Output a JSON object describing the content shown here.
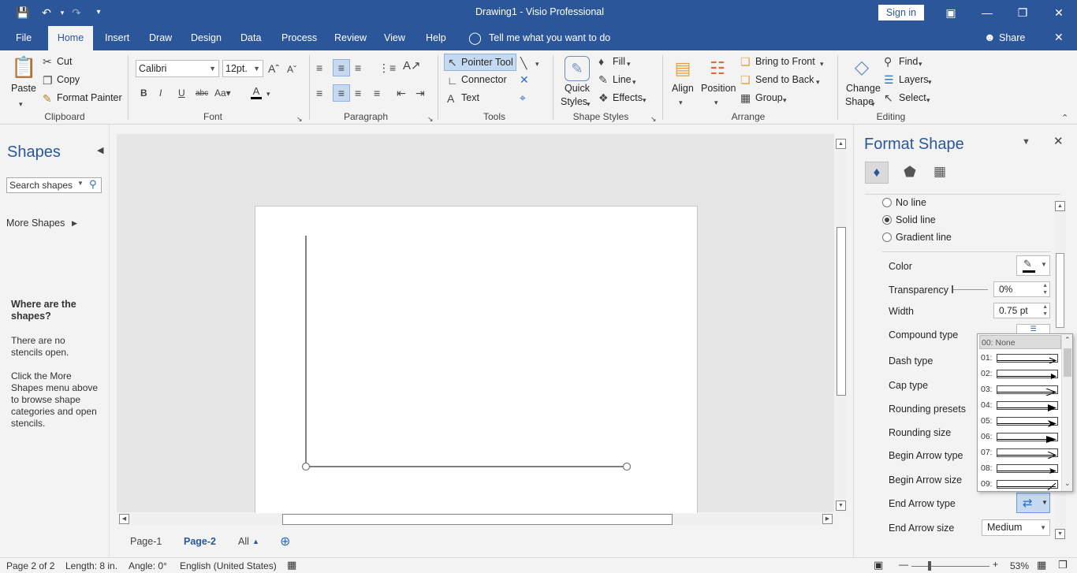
{
  "window": {
    "title": "Drawing1  -  Visio Professional",
    "sign_in": "Sign in"
  },
  "colors": {
    "brand": "#2b579a",
    "canvas": "#e6e6e6",
    "selected_button": "#c5d9f1"
  },
  "menu": {
    "tabs": [
      "File",
      "Home",
      "Insert",
      "Draw",
      "Design",
      "Data",
      "Process",
      "Review",
      "View",
      "Help"
    ],
    "tell_me": "Tell me what you want to do",
    "share": "Share"
  },
  "ribbon": {
    "clipboard": {
      "paste": "Paste",
      "cut": "Cut",
      "copy": "Copy",
      "format_painter": "Format Painter",
      "group": "Clipboard"
    },
    "font": {
      "name": "Calibri",
      "size": "12pt.",
      "group": "Font"
    },
    "paragraph": {
      "group": "Paragraph"
    },
    "tools": {
      "pointer": "Pointer Tool",
      "connector": "Connector",
      "text": "Text",
      "group": "Tools"
    },
    "shape_styles": {
      "quick": "Quick",
      "styles": "Styles",
      "fill": "Fill",
      "line": "Line",
      "effects": "Effects",
      "group": "Shape Styles"
    },
    "arrange": {
      "align": "Align",
      "position": "Position",
      "bring_front": "Bring to Front",
      "send_back": "Send to Back",
      "group_btn": "Group",
      "group": "Arrange"
    },
    "editing": {
      "change": "Change",
      "shape": "Shape",
      "find": "Find",
      "layers": "Layers",
      "select": "Select",
      "group": "Editing"
    }
  },
  "shapes_panel": {
    "title": "Shapes",
    "search_placeholder": "Search shapes",
    "more_shapes": "More Shapes",
    "where_title": "Where are the shapes?",
    "no_stencils": "There are no stencils open.",
    "hint": "Click the More Shapes menu above to browse shape categories and open stencils."
  },
  "pages": {
    "tabs": [
      "Page-1",
      "Page-2"
    ],
    "all": "All",
    "active": "Page-2"
  },
  "status": {
    "page": "Page 2 of 2",
    "length": "Length: 8 in.",
    "angle": "Angle: 0°",
    "language": "English (United States)",
    "zoom": "53%",
    "zoom_fraction": 0.53
  },
  "format_shape": {
    "title": "Format Shape",
    "line_options": [
      "No line",
      "Solid line",
      "Gradient line"
    ],
    "selected_line_option": "Solid line",
    "labels": {
      "color": "Color",
      "transparency": "Transparency",
      "width": "Width",
      "compound": "Compound type",
      "dash": "Dash type",
      "cap": "Cap type",
      "rounding_presets": "Rounding presets",
      "rounding_size": "Rounding size",
      "begin_type": "Begin Arrow type",
      "begin_size": "Begin Arrow size",
      "end_type": "End Arrow type",
      "end_size": "End Arrow size"
    },
    "transparency_value": "0%",
    "width_value": "0.75 pt",
    "end_size_value": "Medium"
  },
  "arrow_list": {
    "items": [
      "00: None",
      "01:",
      "02:",
      "03:",
      "04:",
      "05:",
      "06:",
      "07:",
      "08:",
      "09:"
    ],
    "selected": "00: None"
  }
}
